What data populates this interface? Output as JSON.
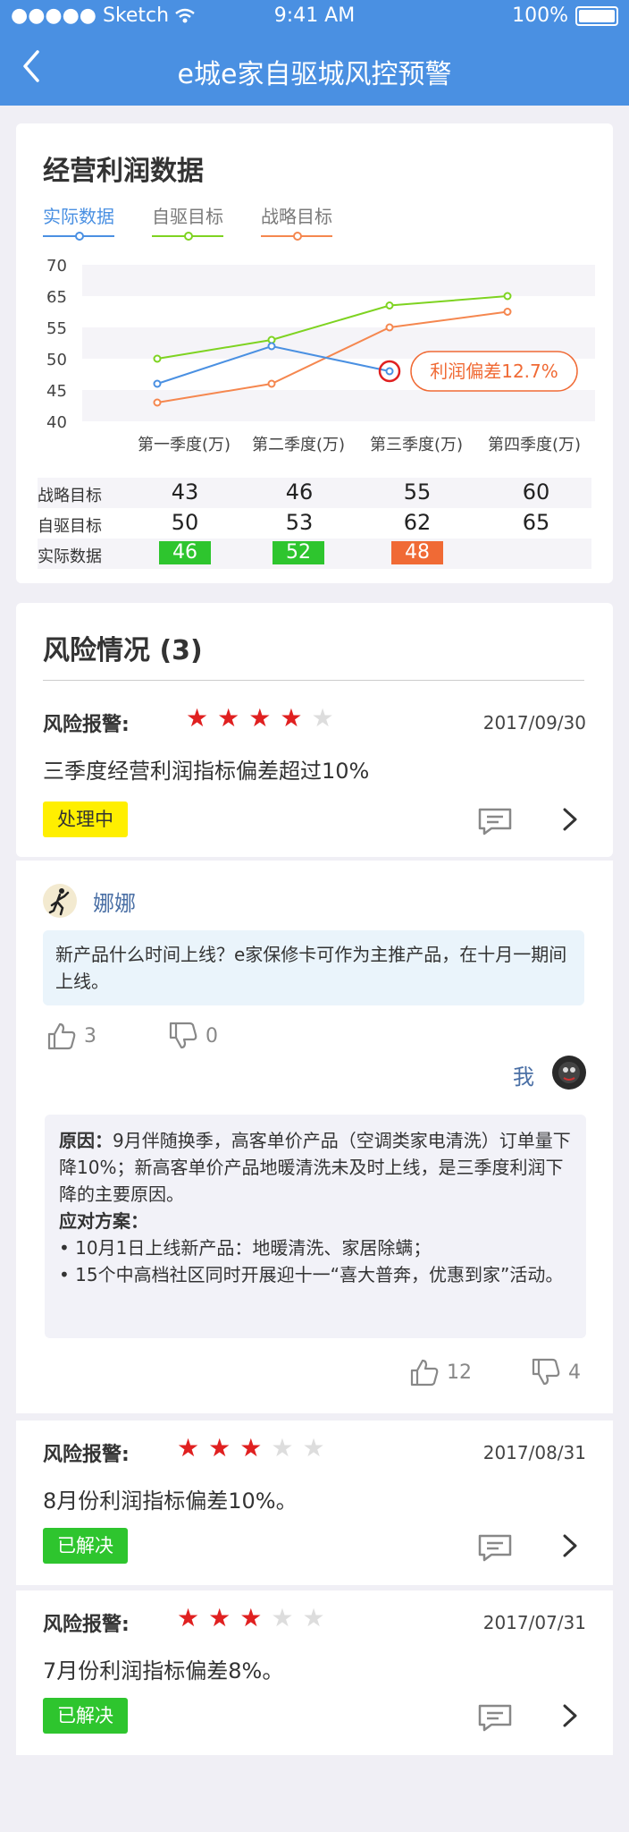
{
  "status_bar": {
    "carrier": "●●●●● Sketch",
    "time": "9:41 AM",
    "battery": "100%"
  },
  "nav": {
    "title": "e城e家自驱城风控预警"
  },
  "profit_section": {
    "title": "经营利润数据",
    "legend": [
      {
        "label": "实际数据",
        "color": "#4a90e2"
      },
      {
        "label": "自驱目标",
        "color": "#7ed321"
      },
      {
        "label": "战略目标",
        "color": "#f5874f"
      }
    ],
    "deviation_label": "利润偏差12.7%",
    "table": {
      "rows": [
        {
          "label": "战略目标",
          "values": [
            "43",
            "46",
            "55",
            "60"
          ]
        },
        {
          "label": "自驱目标",
          "values": [
            "50",
            "53",
            "62",
            "65"
          ]
        },
        {
          "label": "实际数据",
          "values": [
            "46",
            "52",
            "48",
            ""
          ]
        }
      ],
      "badge_colors": [
        "#2ec52e",
        "#2ec52e",
        "#f06a35"
      ]
    }
  },
  "chart_data": {
    "type": "line",
    "categories": [
      "第一季度(万)",
      "第二季度(万)",
      "第三季度(万)",
      "第四季度(万)"
    ],
    "y_ticks": [
      "70",
      "65",
      "55",
      "50",
      "45",
      "40"
    ],
    "series": [
      {
        "name": "实际数据",
        "values": [
          46,
          52,
          48,
          null
        ],
        "color": "#4a90e2"
      },
      {
        "name": "自驱目标",
        "values": [
          50,
          53,
          62,
          65
        ],
        "color": "#7ed321"
      },
      {
        "name": "战略目标",
        "values": [
          43,
          46,
          55,
          60
        ],
        "color": "#f5874f"
      }
    ]
  },
  "risk_section": {
    "title": "风险情况 (3)",
    "alerts": [
      {
        "heading": "风险报警:",
        "stars": 4,
        "date": "2017/09/30",
        "text": "三季度经营利润指标偏差超过10%",
        "status": "处理中"
      },
      {
        "heading": "风险报警:",
        "stars": 3,
        "date": "2017/08/31",
        "text": "8月份利润指标偏差10%。",
        "status": "已解决"
      },
      {
        "heading": "风险报警:",
        "stars": 3,
        "date": "2017/07/31",
        "text": "7月份利润指标偏差8%。",
        "status": "已解决"
      }
    ],
    "comments": {
      "question": {
        "user": "娜娜",
        "text": "新产品什么时间上线？e家保修卡可作为主推产品，在十月一期间上线。",
        "likes": "3",
        "dislikes": "0"
      },
      "reply": {
        "user": "我",
        "reason_label": "原因：",
        "reason_text": "9月伴随换季，高客单价产品（空调类家电清洗）订单量下降10%；新高客单价产品地暖清洗未及时上线，是三季度利润下降的主要原因。",
        "plan_label": "应对方案：",
        "plan_items": [
          "• 10月1日上线新产品：地暖清洗、家居除螨；",
          "• 15个中高档社区同时开展迎十一“喜大普奔，优惠到家”活动。"
        ],
        "likes": "12",
        "dislikes": "4"
      }
    }
  }
}
